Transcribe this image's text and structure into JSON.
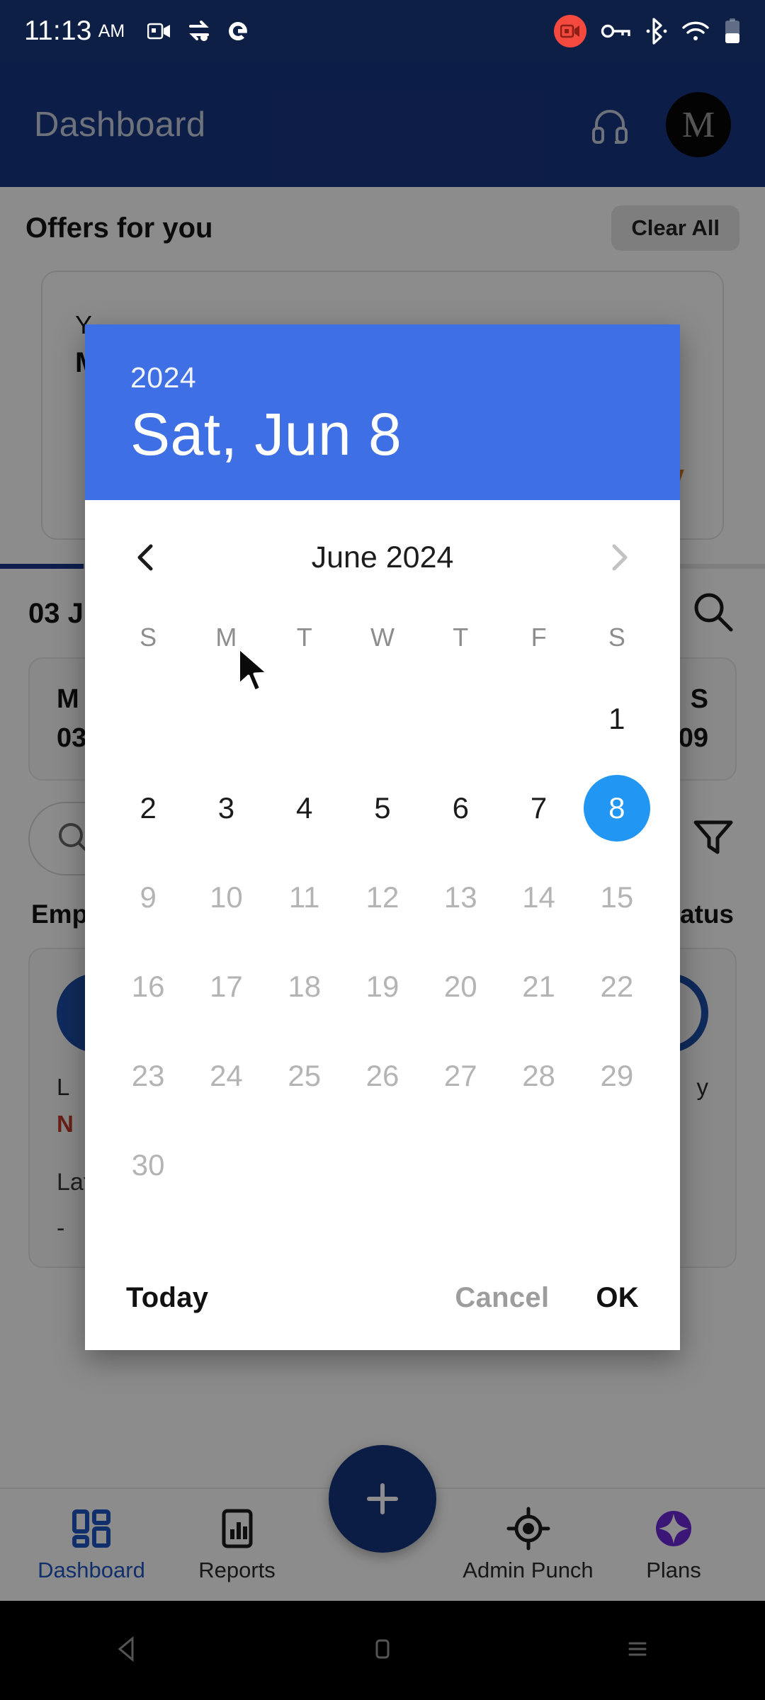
{
  "status_bar": {
    "time": "11:13",
    "ampm": "AM",
    "icons": [
      "video-call-icon",
      "vpn-sync-icon",
      "google-icon",
      "screen-record-icon",
      "vpn-key-icon",
      "bluetooth-icon",
      "wifi-icon",
      "battery-icon"
    ]
  },
  "app_bar": {
    "title": "Dashboard",
    "support_icon": "headset-icon",
    "avatar_initial": "M"
  },
  "background": {
    "offers_title": "Offers for you",
    "clear_all_label": "Clear All",
    "offer_line1": "Y",
    "offer_line2": "M",
    "offer_arrow": "V",
    "date_label": "03 J",
    "summary_left_line1": "M",
    "summary_left_line2": "03",
    "summary_right_line1": "S",
    "summary_right_line2": "09",
    "search_icon": "search-icon",
    "filter_icon": "filter-funnel-icon",
    "col_employee": "Emplo",
    "col_status": "tatus",
    "emp_label_left": "L",
    "emp_label_right": "y",
    "emp_status": "N",
    "latest_activity": "Latest Activity",
    "latest_value": "-"
  },
  "bottom_nav": {
    "items": [
      {
        "label": "Dashboard",
        "icon": "dashboard-grid-icon",
        "active": true
      },
      {
        "label": "Reports",
        "icon": "bar-chart-icon",
        "active": false
      },
      {
        "label": "Admin Punch",
        "icon": "target-crosshair-icon",
        "active": false
      },
      {
        "label": "Plans",
        "icon": "diamond-sparkle-icon",
        "active": false
      }
    ],
    "fab_icon": "plus-icon",
    "active_color": "#1f56c4",
    "fab_color": "#16367e",
    "plans_color": "#6d28d9"
  },
  "android_nav": {
    "back": "back-triangle-icon",
    "home": "home-square-icon",
    "recents": "recents-menu-icon"
  },
  "date_picker": {
    "year": "2024",
    "selected_date_label": "Sat, Jun 8",
    "month_label": "June 2024",
    "prev_icon": "chevron-left-icon",
    "next_icon": "chevron-right-icon",
    "prev_enabled": true,
    "next_enabled": false,
    "weekdays": [
      "S",
      "M",
      "T",
      "W",
      "T",
      "F",
      "S"
    ],
    "header_color": "#3f6fe4",
    "selection_color": "#2196f3",
    "lead_blanks": 6,
    "days": [
      {
        "n": "1",
        "state": "enabled"
      },
      {
        "n": "2",
        "state": "enabled"
      },
      {
        "n": "3",
        "state": "enabled"
      },
      {
        "n": "4",
        "state": "enabled"
      },
      {
        "n": "5",
        "state": "enabled"
      },
      {
        "n": "6",
        "state": "enabled"
      },
      {
        "n": "7",
        "state": "enabled"
      },
      {
        "n": "8",
        "state": "selected"
      },
      {
        "n": "9",
        "state": "disabled"
      },
      {
        "n": "10",
        "state": "disabled"
      },
      {
        "n": "11",
        "state": "disabled"
      },
      {
        "n": "12",
        "state": "disabled"
      },
      {
        "n": "13",
        "state": "disabled"
      },
      {
        "n": "14",
        "state": "disabled"
      },
      {
        "n": "15",
        "state": "disabled"
      },
      {
        "n": "16",
        "state": "disabled"
      },
      {
        "n": "17",
        "state": "disabled"
      },
      {
        "n": "18",
        "state": "disabled"
      },
      {
        "n": "19",
        "state": "disabled"
      },
      {
        "n": "20",
        "state": "disabled"
      },
      {
        "n": "21",
        "state": "disabled"
      },
      {
        "n": "22",
        "state": "disabled"
      },
      {
        "n": "23",
        "state": "disabled"
      },
      {
        "n": "24",
        "state": "disabled"
      },
      {
        "n": "25",
        "state": "disabled"
      },
      {
        "n": "26",
        "state": "disabled"
      },
      {
        "n": "27",
        "state": "disabled"
      },
      {
        "n": "28",
        "state": "disabled"
      },
      {
        "n": "29",
        "state": "disabled"
      },
      {
        "n": "30",
        "state": "disabled"
      }
    ],
    "today_label": "Today",
    "cancel_label": "Cancel",
    "ok_label": "OK"
  }
}
